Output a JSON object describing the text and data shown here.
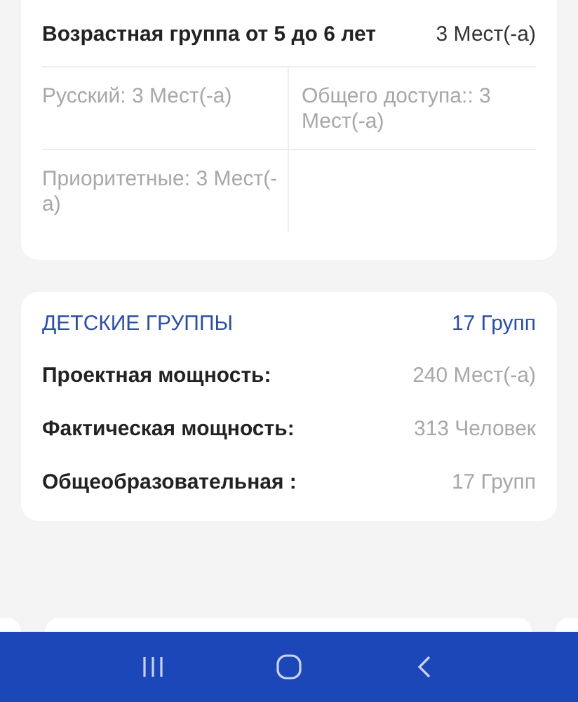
{
  "age_group": {
    "title": "Возрастная группа от 5 до 6 лет",
    "value": "3 Мест(-а)",
    "cells": [
      "Русский: 3 Мест(-а)",
      "Общего доступа:: 3 Мест(-а)",
      "Приоритетные: 3 Мест(-а)"
    ]
  },
  "children_groups": {
    "title": "ДЕТСКИЕ ГРУППЫ",
    "count": "17 Групп",
    "rows": [
      {
        "label": "Проектная мощность:",
        "value": "240 Мест(-а)"
      },
      {
        "label": "Фактическая мощность:",
        "value": "313 Человек"
      },
      {
        "label": "Общеобразовательная :",
        "value": "17 Групп"
      }
    ]
  }
}
